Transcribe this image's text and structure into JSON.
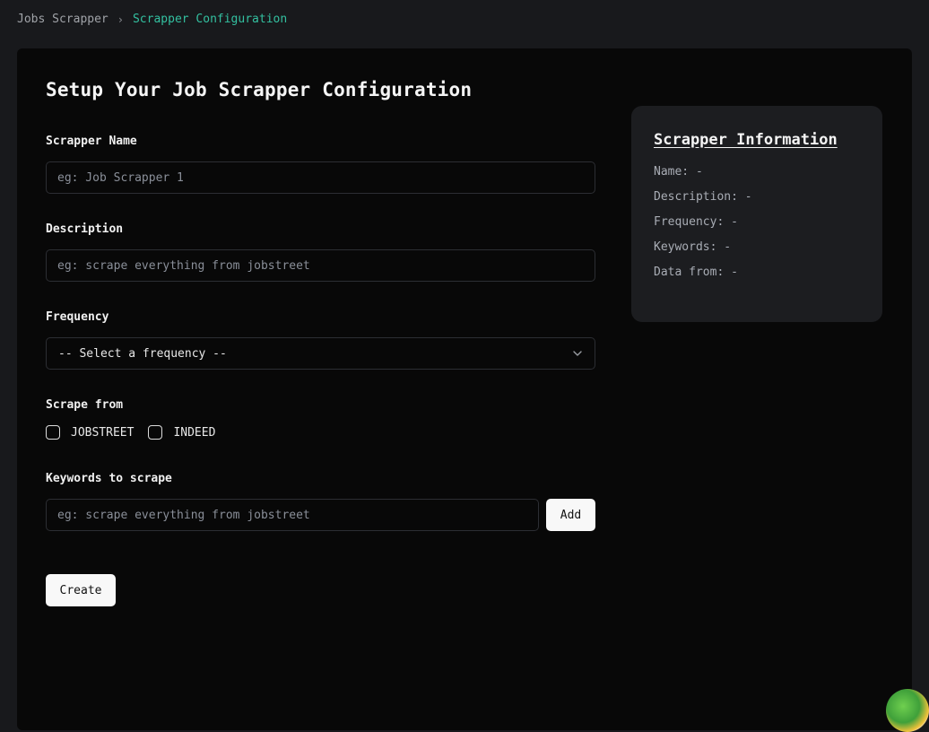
{
  "breadcrumb": {
    "root": "Jobs Scrapper",
    "separator": "›",
    "current": "Scrapper Configuration"
  },
  "form": {
    "title": "Setup Your Job Scrapper Configuration",
    "name": {
      "label": "Scrapper Name",
      "placeholder": "eg: Job Scrapper 1",
      "value": ""
    },
    "description": {
      "label": "Description",
      "placeholder": "eg: scrape everything from jobstreet",
      "value": ""
    },
    "frequency": {
      "label": "Frequency",
      "selected": "-- Select a frequency --"
    },
    "scrape_from": {
      "label": "Scrape from",
      "options": [
        {
          "label": "JOBSTREET",
          "checked": false
        },
        {
          "label": "INDEED",
          "checked": false
        }
      ]
    },
    "keywords": {
      "label": "Keywords to scrape",
      "placeholder": "eg: scrape everything from jobstreet",
      "value": "",
      "add_label": "Add"
    },
    "create_label": "Create"
  },
  "info": {
    "title": "Scrapper Information",
    "lines": [
      "Name: -",
      "Description: -",
      "Frequency: -",
      "Keywords: -",
      "Data from: -"
    ]
  },
  "colors": {
    "accent": "#33c0a0",
    "background": "#18191c",
    "panel": "#080808",
    "card": "#1c1d20"
  }
}
